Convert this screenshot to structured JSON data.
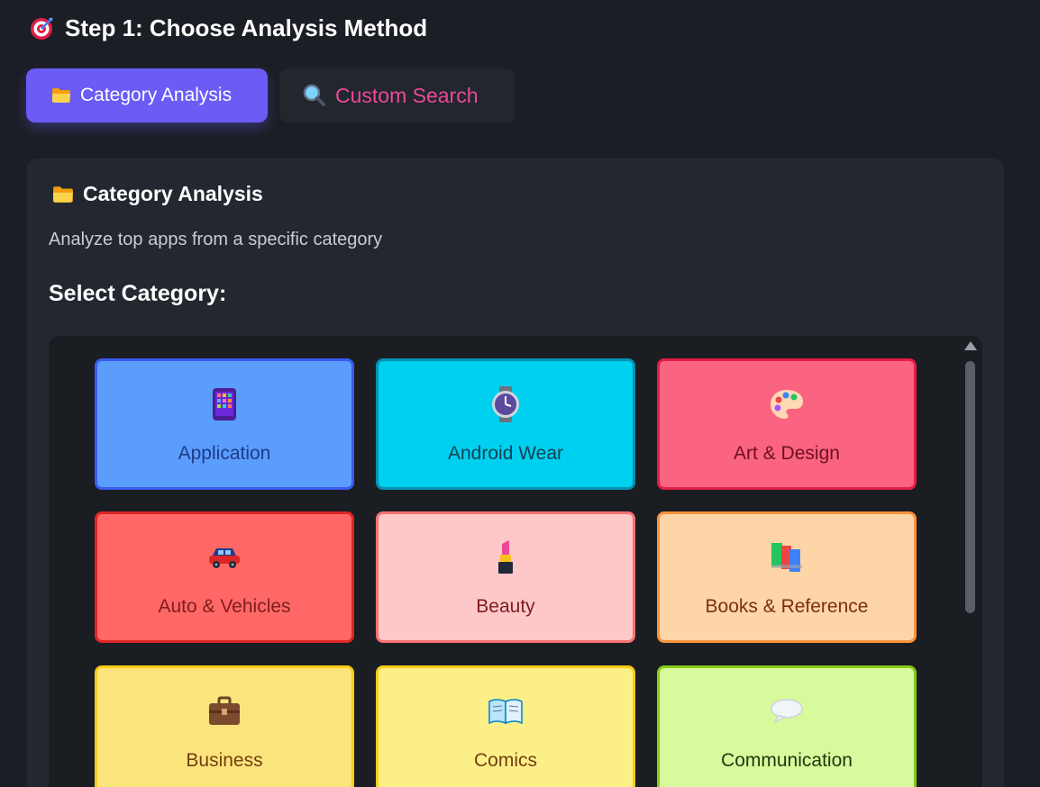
{
  "step": {
    "title": "Step 1: Choose Analysis Method",
    "icon": "target-icon"
  },
  "tabs": [
    {
      "label": "Category Analysis",
      "icon": "folder-icon",
      "active": true
    },
    {
      "label": "Custom Search",
      "icon": "magnifier-icon",
      "active": false
    }
  ],
  "panel": {
    "title": "Category Analysis",
    "icon": "folder-icon",
    "description": "Analyze top apps from a specific category",
    "select_label": "Select Category:"
  },
  "categories": [
    {
      "label": "Application",
      "icon": "phone-apps-icon",
      "bg": "#5b9dfc",
      "border": "#3b5bf0",
      "text": "#1e3a8a"
    },
    {
      "label": "Android Wear",
      "icon": "watch-icon",
      "bg": "#00d0f0",
      "border": "#0891b2",
      "text": "#0f4250"
    },
    {
      "label": "Art & Design",
      "icon": "palette-icon",
      "bg": "#fb6480",
      "border": "#e11d48",
      "text": "#6b1020"
    },
    {
      "label": "Auto & Vehicles",
      "icon": "car-icon",
      "bg": "#ff6866",
      "border": "#dc2626",
      "text": "#7f1d1d"
    },
    {
      "label": "Beauty",
      "icon": "lipstick-icon",
      "bg": "#fec8c9",
      "border": "#f87171",
      "text": "#7f1d1d"
    },
    {
      "label": "Books & Reference",
      "icon": "books-icon",
      "bg": "#fed5a6",
      "border": "#fb923c",
      "text": "#7c2d12"
    },
    {
      "label": "Business",
      "icon": "briefcase-icon",
      "bg": "#fbe47c",
      "border": "#facc15",
      "text": "#713f12"
    },
    {
      "label": "Comics",
      "icon": "open-book-icon",
      "bg": "#fdef88",
      "border": "#facc15",
      "text": "#713f12"
    },
    {
      "label": "Communication",
      "icon": "speech-bubble-icon",
      "bg": "#d9f99d",
      "border": "#84cc16",
      "text": "#1a3a0e"
    }
  ]
}
